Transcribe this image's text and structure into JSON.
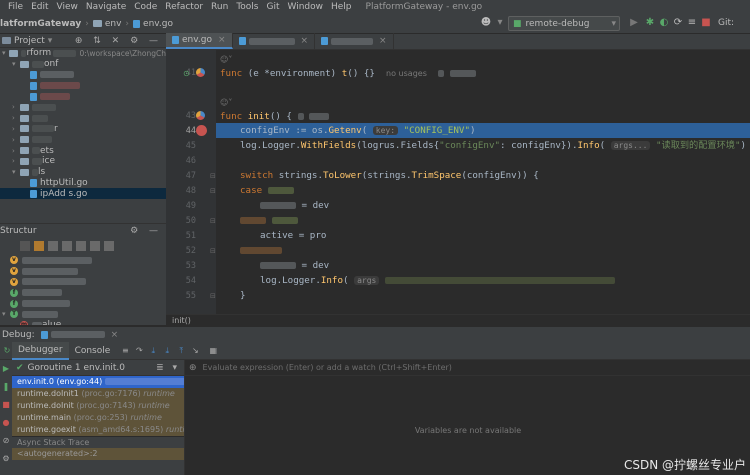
{
  "menu": [
    "File",
    "Edit",
    "View",
    "Navigate",
    "Code",
    "Refactor",
    "Run",
    "Tools",
    "Git",
    "Window",
    "Help"
  ],
  "window_title": "PlatformGateway - env.go",
  "nav": {
    "project": "latformGateway",
    "dir": "env",
    "file": "env.go"
  },
  "toolbar": {
    "run_config": "remote-debug",
    "git_label": "Git:"
  },
  "project_panel": {
    "title": "Project",
    "items": [
      {
        "label": "rform",
        "extra": "0:\\workspace\\ZhongCh"
      },
      {
        "label": "onf"
      },
      {
        "label": ""
      },
      {
        "label": ""
      },
      {
        "label": ""
      },
      {
        "label": ""
      },
      {
        "label": ""
      },
      {
        "label": "r"
      },
      {
        "label": ""
      },
      {
        "label": "ets"
      },
      {
        "label": "ice"
      },
      {
        "label": "ls"
      },
      {
        "label": "httpUtil.go"
      },
      {
        "label": "ipAdd   s.go"
      }
    ]
  },
  "structure_panel": {
    "title": "Structur",
    "items": [
      "",
      "",
      "",
      "",
      "",
      "",
      "alue"
    ]
  },
  "editor": {
    "tabs": [
      "env.go",
      "",
      ""
    ],
    "lines": [
      {
        "num": "",
        "type": "hint"
      },
      {
        "num": "41",
        "type": "func_t"
      },
      {
        "num": "",
        "type": "blank"
      },
      {
        "num": "",
        "type": "hint"
      },
      {
        "num": "43",
        "type": "func_init"
      },
      {
        "num": "44",
        "type": "getenv"
      },
      {
        "num": "45",
        "type": "log1"
      },
      {
        "num": "46",
        "type": "empty"
      },
      {
        "num": "47",
        "type": "switch"
      },
      {
        "num": "48",
        "type": "case1"
      },
      {
        "num": "49",
        "type": "dev1"
      },
      {
        "num": "50",
        "type": "case2"
      },
      {
        "num": "51",
        "type": "pro"
      },
      {
        "num": "52",
        "type": "default"
      },
      {
        "num": "53",
        "type": "dev2"
      },
      {
        "num": "54",
        "type": "log2"
      },
      {
        "num": "55",
        "type": "close"
      }
    ],
    "tokens": {
      "func": "func",
      "recv": "(e *environment)",
      "t_name": "t",
      "t_rest": "() {}",
      "no_usages": "no usages",
      "init_name": "init",
      "init_rest": "() {",
      "configEnv": "configEnv := os.",
      "getenv": "Getenv",
      "key_hint": "key:",
      "config_str": "\"CONFIG_ENV\"",
      "log_line": "log.Logger.",
      "withfields": "WithFields",
      "logrus": "(logrus.Fields{",
      "fields_key": "\"configEnv\"",
      "fields_val": ": configEnv}).",
      "info": "Info",
      "args_hint": "args...",
      "info_str": "\"读取到的配置环境\"",
      "close_paren": ")",
      "switch_kw": "switch",
      "strings": " strings.",
      "tolower": "ToLower",
      "trimspace_pre": "(strings.",
      "trimspace": "TrimSpace",
      "switch_rest": "(configEnv)) {",
      "case": "case",
      "dev_assign": " = dev",
      "active_pro": "active = pro",
      "log2_pre": "log.Logger.",
      "log2_info": "Info",
      "log2_rest": "(",
      "args2": "args",
      "brace": "}"
    }
  },
  "breadcrumb_bottom": "init()",
  "debug": {
    "title": "Debug:",
    "tabs": [
      "Debugger",
      "Console"
    ],
    "goroutine": "Goroutine 1 env.init.0",
    "eval_placeholder": "Evaluate expression (Enter) or add a watch (Ctrl+Shift+Enter)",
    "frames": [
      {
        "name": "env.init.0",
        "loc": "(env.go:44)",
        "tag": ""
      },
      {
        "name": "runtime.doInit1",
        "loc": "(proc.go:7176)",
        "tag": "runtime"
      },
      {
        "name": "runtime.doInit",
        "loc": "(proc.go:7143)",
        "tag": "runtime"
      },
      {
        "name": "runtime.main",
        "loc": "(proc.go:253)",
        "tag": "runtime"
      },
      {
        "name": "runtime.goexit",
        "loc": "(asm_amd64.s:1695)",
        "tag": "runtime"
      }
    ],
    "async_label": "Async Stack Trace",
    "autogenerated": "<autogenerated>:2",
    "no_vars": "Variables are not available"
  },
  "watermark": "CSDN @拧螺丝专业户",
  "colors": {
    "accent": "#4a88c7",
    "selection": "#2d6099",
    "frame_sel": "#2f65ca"
  }
}
